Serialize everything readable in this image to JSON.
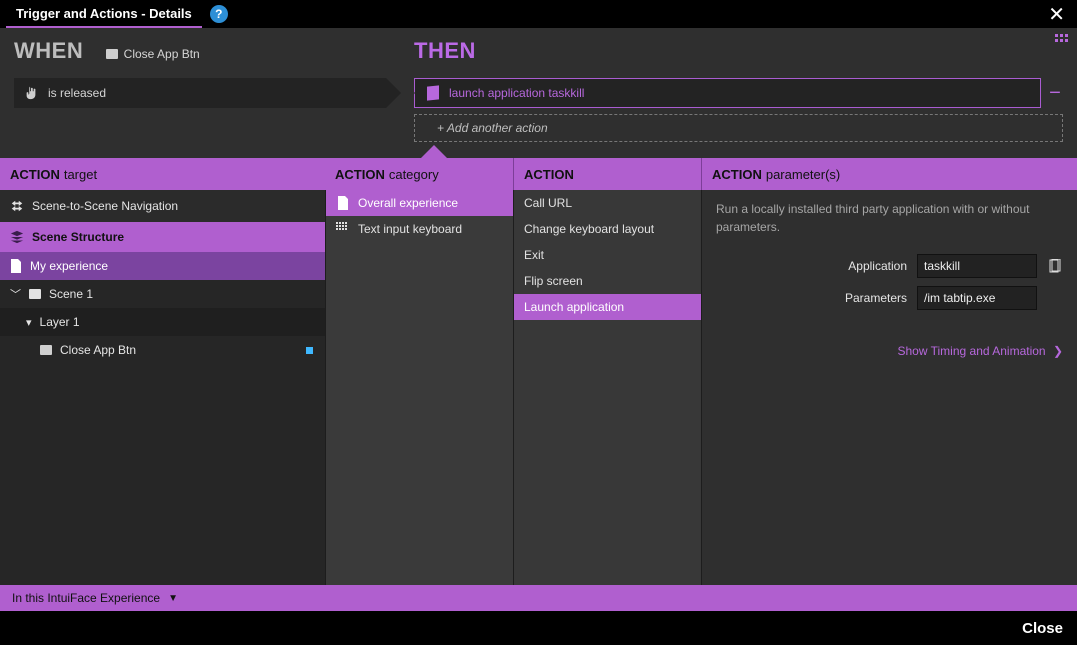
{
  "window": {
    "title": "Trigger and Actions - Details",
    "help_tooltip": "?"
  },
  "when": {
    "label": "WHEN",
    "target": "Close App Btn",
    "trigger": "is released"
  },
  "then": {
    "label": "THEN",
    "action": "launch application taskkill",
    "add_label": "+  Add another action"
  },
  "columns": {
    "target": {
      "h": "ACTION",
      "s": "target"
    },
    "category": {
      "h": "ACTION",
      "s": "category"
    },
    "action": {
      "h": "ACTION",
      "s": ""
    },
    "parameters": {
      "h": "ACTION",
      "s": "parameter(s)"
    }
  },
  "tree": {
    "nav": "Scene-to-Scene Navigation",
    "structure": "Scene Structure",
    "experience": "My experience",
    "scene": "Scene 1",
    "layer": "Layer 1",
    "element": "Close App Btn"
  },
  "categories": [
    {
      "label": "Overall experience",
      "selected": true,
      "icon": "doc"
    },
    {
      "label": "Text input keyboard",
      "selected": false,
      "icon": "keys"
    }
  ],
  "actions": [
    {
      "label": "Call URL",
      "selected": false
    },
    {
      "label": "Change keyboard layout",
      "selected": false
    },
    {
      "label": "Exit",
      "selected": false
    },
    {
      "label": "Flip screen",
      "selected": false
    },
    {
      "label": "Launch application",
      "selected": true
    }
  ],
  "parameters": {
    "description": "Run a locally installed third party application with or without parameters.",
    "application_label": "Application",
    "application_value": "taskkill",
    "parameters_label": "Parameters",
    "parameters_value": "/im tabtip.exe",
    "timing_link": "Show Timing and Animation"
  },
  "footer": {
    "scope": "In this IntuiFace Experience"
  },
  "bottom": {
    "close": "Close"
  }
}
